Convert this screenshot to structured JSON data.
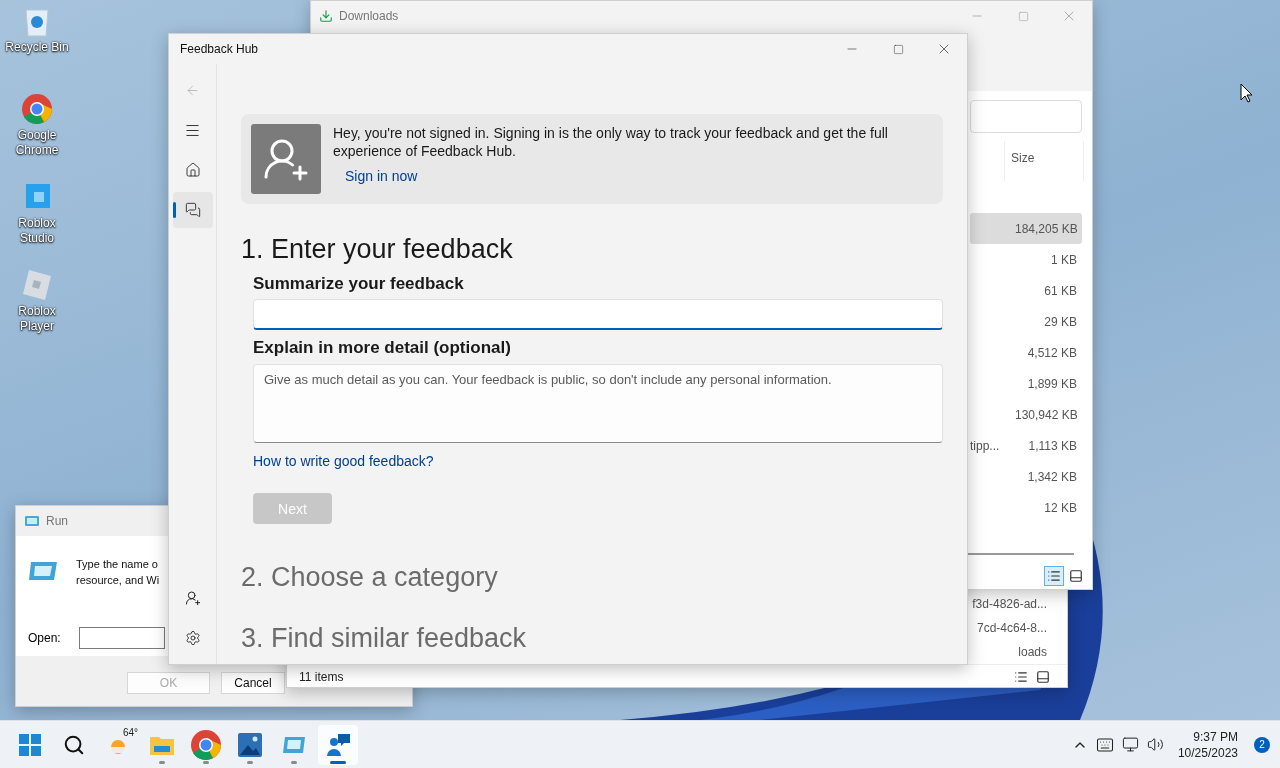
{
  "desktop_icons": [
    {
      "kind": "recycle",
      "label": "Recycle Bin"
    },
    {
      "kind": "chrome",
      "label": "Google Chrome"
    },
    {
      "kind": "studio",
      "label": "Roblox Studio"
    },
    {
      "kind": "player",
      "label": "Roblox Player"
    }
  ],
  "run_dialog": {
    "title": "Run",
    "prompt_lines": [
      "Type the name o",
      "resource, and Wi"
    ],
    "open_label": "Open:",
    "buttons": [
      {
        "label": "OK",
        "disabled": true
      },
      {
        "label": "Cancel",
        "disabled": false
      }
    ]
  },
  "explorer_behind": {
    "rows": [
      "f3d-4826-ad...",
      "7cd-4c64-8...",
      "loads"
    ],
    "status": "11 items",
    "views": [
      {
        "kind": "details",
        "selected": false
      },
      {
        "kind": "tiles",
        "selected": false
      }
    ]
  },
  "downloads_window": {
    "title": "Downloads",
    "size_header": "Size",
    "rows": [
      {
        "size": "184,205 KB",
        "selected": true
      },
      {
        "size": "1 KB",
        "selected": false
      },
      {
        "size": "61 KB",
        "selected": false
      },
      {
        "size": "29 KB",
        "selected": false
      },
      {
        "size": "4,512 KB",
        "selected": false
      },
      {
        "size": "1,899 KB",
        "selected": false
      },
      {
        "size": "130,942 KB",
        "selected": false
      },
      {
        "name": "tipp...",
        "size": "1,113 KB",
        "selected": false
      },
      {
        "size": "1,342 KB",
        "selected": false
      },
      {
        "size": "12 KB",
        "selected": false
      }
    ],
    "views": [
      {
        "kind": "details",
        "selected": true
      },
      {
        "kind": "tiles",
        "selected": false
      }
    ]
  },
  "feedback_hub": {
    "title": "Feedback Hub",
    "nav_top": [
      {
        "kind": "back",
        "disabled": true,
        "selected": false
      },
      {
        "kind": "menu",
        "disabled": false,
        "selected": false
      },
      {
        "kind": "home",
        "disabled": false,
        "selected": false
      },
      {
        "kind": "feedback",
        "disabled": false,
        "selected": true
      }
    ],
    "nav_bottom": [
      {
        "kind": "account",
        "disabled": false,
        "selected": false
      },
      {
        "kind": "settings",
        "disabled": false,
        "selected": false
      }
    ],
    "banner": {
      "message": "Hey, you're not signed in. Signing in is the only way to track your feedback and get the full experience of Feedback Hub.",
      "link": "Sign in now"
    },
    "steps": [
      {
        "title": "1. Enter your feedback",
        "active": true
      },
      {
        "title": "2. Choose a category",
        "active": false
      },
      {
        "title": "3. Find similar feedback",
        "active": false
      }
    ],
    "summary_label": "Summarize your feedback",
    "detail_label": "Explain in more detail (optional)",
    "detail": {
      "placeholder": "Give as much detail as you can. Your feedback is public, so don't include any personal information."
    },
    "help_link": "How to write good feedback?",
    "next_button": {
      "label": "Next",
      "disabled": true
    }
  },
  "taskbar": {
    "apps": [
      {
        "kind": "start",
        "running": false,
        "selected": false
      },
      {
        "kind": "search",
        "running": false,
        "selected": false
      },
      {
        "kind": "weather",
        "label": "64°",
        "running": false,
        "selected": false
      },
      {
        "kind": "files",
        "running": true,
        "selected": false
      },
      {
        "kind": "chrome",
        "running": true,
        "selected": false
      },
      {
        "kind": "photos",
        "running": true,
        "selected": false
      },
      {
        "kind": "run",
        "running": true,
        "selected": false
      },
      {
        "kind": "feedback",
        "running": true,
        "selected": true
      }
    ],
    "time": "9:37 PM",
    "date": "10/25/2023",
    "notifications": "2"
  }
}
